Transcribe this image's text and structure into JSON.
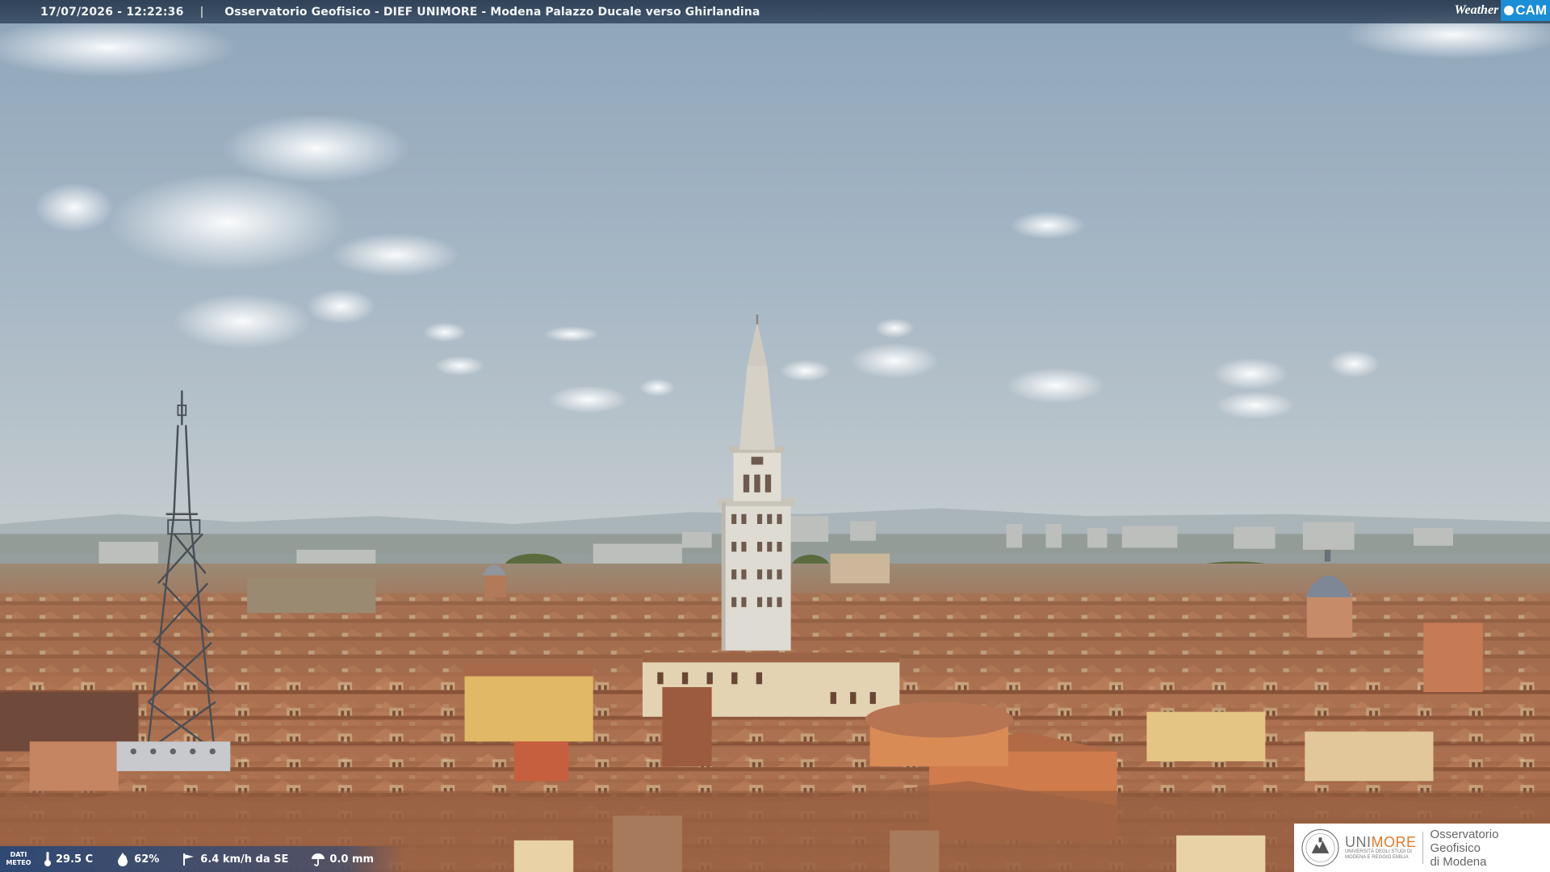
{
  "overlay": {
    "timestamp": "17/07/2026 - 12:22:36",
    "separator": "|",
    "title": "Osservatorio Geofisico - DIEF UNIMORE - Modena Palazzo Ducale verso Ghirlandina",
    "brand_left": "Weather",
    "brand_right": "CAM"
  },
  "meteo": {
    "label_line1": "DATI",
    "label_line2": "METEO",
    "temperature": "29.5 C",
    "humidity": "62%",
    "wind": "6.4 km/h da SE",
    "rain": "0.0 mm"
  },
  "logo": {
    "brand_a": "UNI",
    "brand_b": "MORE",
    "brand_sub_1": "UNIVERSITÀ DEGLI STUDI DI",
    "brand_sub_2": "MODENA E REGGIO EMILIA",
    "obs_line1": "Osservatorio Geofisico",
    "obs_line2": "di Modena"
  },
  "colors": {
    "sky_top": "#8fa6bb",
    "sky_bottom": "#c3cbce",
    "roof": "#b0714a",
    "tower_stone": "#ddd9d0",
    "brand_accent": "#1b8ed6",
    "unimore_orange": "#e07b2a"
  }
}
